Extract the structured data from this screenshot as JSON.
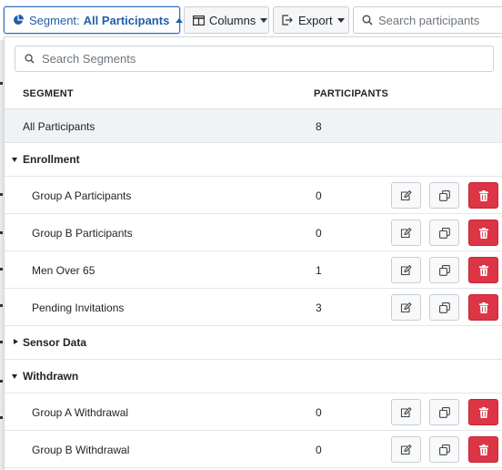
{
  "toolbar": {
    "segment_label": "Segment:",
    "segment_value": "All Participants",
    "columns_label": "Columns",
    "export_label": "Export",
    "search_placeholder": "Search participants"
  },
  "dropdown": {
    "search_placeholder": "Search Segments",
    "header_segment": "SEGMENT",
    "header_participants": "PARTICIPANTS",
    "all": {
      "name": "All Participants",
      "count": "8"
    },
    "groups": [
      {
        "title": "Enrollment",
        "expanded": true,
        "items": [
          {
            "name": "Group A Participants",
            "count": "0"
          },
          {
            "name": "Group B Participants",
            "count": "0"
          },
          {
            "name": "Men Over 65",
            "count": "1"
          },
          {
            "name": "Pending Invitations",
            "count": "3"
          }
        ]
      },
      {
        "title": "Sensor Data",
        "expanded": false,
        "items": []
      },
      {
        "title": "Withdrawn",
        "expanded": true,
        "items": [
          {
            "name": "Group A Withdrawal",
            "count": "0"
          },
          {
            "name": "Group B Withdrawal",
            "count": "0"
          }
        ]
      }
    ]
  },
  "colors": {
    "accent": "#1f5fa8",
    "danger": "#dc3545",
    "row_highlight": "#f0f2f4"
  },
  "icons": [
    "pie-chart-icon",
    "columns-icon",
    "export-icon",
    "search-icon",
    "edit-icon",
    "copy-icon",
    "trash-icon"
  ]
}
